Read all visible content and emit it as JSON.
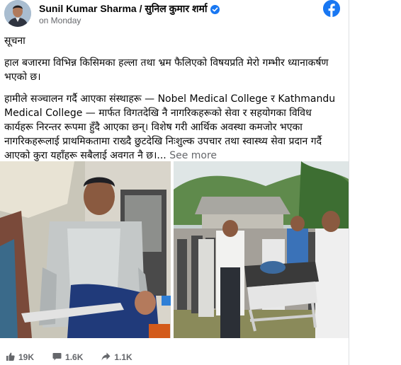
{
  "post": {
    "author": "Sunil Kumar Sharma / सुनिल कुमार शर्मा",
    "time": "on Monday",
    "paragraphs": [
      "सूचना",
      "हाल बजारमा विभिन्न किसिमका हल्ला तथा भ्रम फैलिएको विषयप्रति मेरो गम्भीर ध्यानाकर्षण भएको छ।",
      "हामीले सञ्चालन गर्दै आएका संस्थाहरू — Nobel Medical College र Kathmandu Medical College — मार्फत विगतदेखि नै नागरिकहरूको सेवा र सहयोगका विविध कार्यहरू निरन्तर रूपमा हुँदै आएका छन्। विशेष गरी आर्थिक अवस्था कमजोर भएका नागरिकहरूलाई प्राथमिकतामा राख्दै छुटदेखि निःशुल्क उपचार तथा स्वास्थ्य सेवा प्रदान गर्दै आएको कुरा यहाँहरू सबैलाई अवगत नै छ।..."
    ],
    "see_more": "See more"
  },
  "footer": {
    "likes": "19K",
    "comments": "1.6K",
    "shares": "1.1K"
  },
  "icons": {
    "brand": "facebook-icon",
    "verified": "verified-badge-icon",
    "like": "thumbs-up-icon",
    "comment": "comment-icon",
    "share": "share-arrow-icon"
  },
  "colors": {
    "brand_blue": "#1877f2",
    "meta_gray": "#65676b"
  }
}
